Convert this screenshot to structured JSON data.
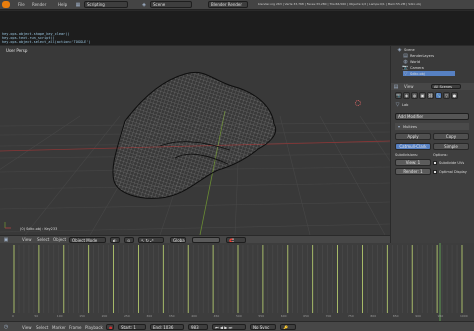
{
  "topbar": {
    "menus": [
      "File",
      "Render",
      "Help"
    ],
    "layout": "Scripting",
    "scene": "Scene",
    "engine": "Blender Render",
    "info": "blender.org 263 | Verts:33,768 | Faces:33,280 | Tris:66,560 | Objects:1/2 | Lamps:0/1 | Mem:55.2M | Sdkc.obj"
  },
  "console": {
    "lines": [
      "hey.ops.object.shape_key_clear()",
      "hey.ops.text.run_script()",
      "hey.ops.object.select_all(action='TOGGLE')"
    ]
  },
  "viewport": {
    "label": "User Persp",
    "object_label": "(0) Sdkc.obj : Key233",
    "mode": "Object Mode",
    "pivot": "Global",
    "menus": [
      "View",
      "Select",
      "Object"
    ]
  },
  "outliner": {
    "items": [
      "Scene",
      "RenderLayers",
      "World",
      "Camera",
      "Sdkc.obj"
    ],
    "view_tab": "View",
    "search_tab": "All Scenes"
  },
  "properties": {
    "object_name": "Lab",
    "add_modifier": "Add Modifier",
    "modifier_name": "Multires",
    "apply": "Apply",
    "copy": "Copy",
    "catmull_clark": "Catmull-Clark",
    "simple": "Simple",
    "subdivisions_label": "Subdivisions:",
    "options_label": "Options:",
    "view_field": "View: 1",
    "render_field": "Render: 1",
    "subdivide_uvs": "Subdivide UVs",
    "optimal_display": "Optimal Display"
  },
  "timeline": {
    "menus": [
      "View",
      "Select",
      "Marker",
      "Frame",
      "Playback"
    ],
    "start": "Start: 1",
    "end": "End: 1036",
    "current": "983",
    "sync": "No Sync",
    "mode": "Object Mode",
    "ticks": [
      "0",
      "50",
      "100",
      "150",
      "200",
      "250",
      "300",
      "350",
      "400",
      "450",
      "500",
      "550",
      "600",
      "650",
      "700",
      "750",
      "800",
      "850",
      "900",
      "950",
      "1000"
    ]
  },
  "colors": {
    "accent": "#5680c2",
    "keyframe": "#b2c86e",
    "grid_x": "#8c3636",
    "grid_y": "#6a8d33"
  }
}
